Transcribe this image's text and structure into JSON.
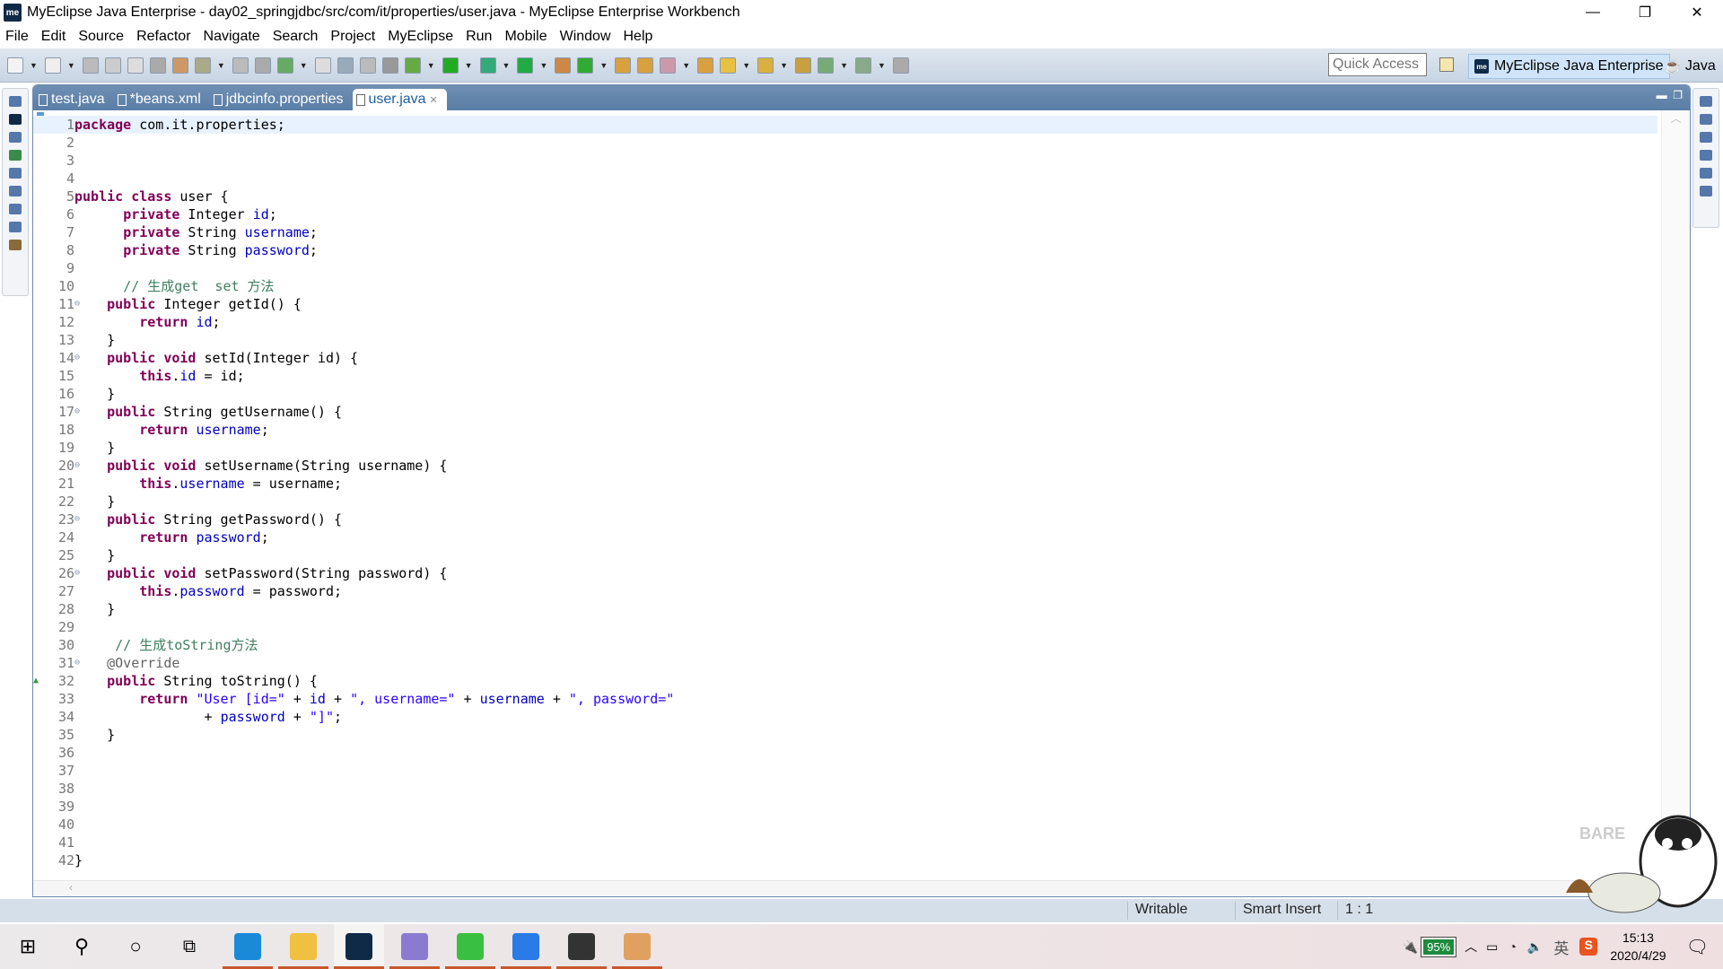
{
  "window": {
    "title": "MyEclipse Java Enterprise - day02_springjdbc/src/com/it/properties/user.java - MyEclipse Enterprise Workbench",
    "logo": "me"
  },
  "menu": [
    "File",
    "Edit",
    "Source",
    "Refactor",
    "Navigate",
    "Search",
    "Project",
    "MyEclipse",
    "Run",
    "Mobile",
    "Window",
    "Help"
  ],
  "toolbar": {
    "quick_access_placeholder": "Quick Access",
    "perspective_active": "MyEclipse Java Enterprise",
    "perspective_other": "Java"
  },
  "tabs": [
    {
      "label": "test.java"
    },
    {
      "label": "*beans.xml"
    },
    {
      "label": "jdbcinfo.properties"
    },
    {
      "label": "user.java",
      "active": true
    }
  ],
  "code": [
    [
      [
        "kw",
        "package"
      ],
      [
        "p",
        " com.it.properties;"
      ]
    ],
    [],
    [],
    [],
    [
      [
        "kw",
        "public"
      ],
      [
        "p",
        " "
      ],
      [
        "kw",
        "class"
      ],
      [
        "p",
        " user {"
      ]
    ],
    [
      [
        "p",
        "      "
      ],
      [
        "kw",
        "private"
      ],
      [
        "p",
        " Integer "
      ],
      [
        "fd",
        "id"
      ],
      [
        "p",
        ";"
      ]
    ],
    [
      [
        "p",
        "      "
      ],
      [
        "kw",
        "private"
      ],
      [
        "p",
        " String "
      ],
      [
        "fd",
        "username"
      ],
      [
        "p",
        ";"
      ]
    ],
    [
      [
        "p",
        "      "
      ],
      [
        "kw",
        "private"
      ],
      [
        "p",
        " String "
      ],
      [
        "fd",
        "password"
      ],
      [
        "p",
        ";"
      ]
    ],
    [],
    [
      [
        "p",
        "      "
      ],
      [
        "cm",
        "// 生成get  set 方法"
      ]
    ],
    [
      [
        "p",
        "    "
      ],
      [
        "kw",
        "public"
      ],
      [
        "p",
        " Integer getId() {"
      ]
    ],
    [
      [
        "p",
        "        "
      ],
      [
        "kw",
        "return"
      ],
      [
        "p",
        " "
      ],
      [
        "fd",
        "id"
      ],
      [
        "p",
        ";"
      ]
    ],
    [
      [
        "p",
        "    }"
      ]
    ],
    [
      [
        "p",
        "    "
      ],
      [
        "kw",
        "public"
      ],
      [
        "p",
        " "
      ],
      [
        "kw",
        "void"
      ],
      [
        "p",
        " setId(Integer id) {"
      ]
    ],
    [
      [
        "p",
        "        "
      ],
      [
        "kw",
        "this"
      ],
      [
        "p",
        "."
      ],
      [
        "fd",
        "id"
      ],
      [
        "p",
        " = id;"
      ]
    ],
    [
      [
        "p",
        "    }"
      ]
    ],
    [
      [
        "p",
        "    "
      ],
      [
        "kw",
        "public"
      ],
      [
        "p",
        " String getUsername() {"
      ]
    ],
    [
      [
        "p",
        "        "
      ],
      [
        "kw",
        "return"
      ],
      [
        "p",
        " "
      ],
      [
        "fd",
        "username"
      ],
      [
        "p",
        ";"
      ]
    ],
    [
      [
        "p",
        "    }"
      ]
    ],
    [
      [
        "p",
        "    "
      ],
      [
        "kw",
        "public"
      ],
      [
        "p",
        " "
      ],
      [
        "kw",
        "void"
      ],
      [
        "p",
        " setUsername(String username) {"
      ]
    ],
    [
      [
        "p",
        "        "
      ],
      [
        "kw",
        "this"
      ],
      [
        "p",
        "."
      ],
      [
        "fd",
        "username"
      ],
      [
        "p",
        " = username;"
      ]
    ],
    [
      [
        "p",
        "    }"
      ]
    ],
    [
      [
        "p",
        "    "
      ],
      [
        "kw",
        "public"
      ],
      [
        "p",
        " String getPassword() {"
      ]
    ],
    [
      [
        "p",
        "        "
      ],
      [
        "kw",
        "return"
      ],
      [
        "p",
        " "
      ],
      [
        "fd",
        "password"
      ],
      [
        "p",
        ";"
      ]
    ],
    [
      [
        "p",
        "    }"
      ]
    ],
    [
      [
        "p",
        "    "
      ],
      [
        "kw",
        "public"
      ],
      [
        "p",
        " "
      ],
      [
        "kw",
        "void"
      ],
      [
        "p",
        " setPassword(String password) {"
      ]
    ],
    [
      [
        "p",
        "        "
      ],
      [
        "kw",
        "this"
      ],
      [
        "p",
        "."
      ],
      [
        "fd",
        "password"
      ],
      [
        "p",
        " = password;"
      ]
    ],
    [
      [
        "p",
        "    }"
      ]
    ],
    [],
    [
      [
        "p",
        "     "
      ],
      [
        "cm",
        "// 生成toString方法"
      ]
    ],
    [
      [
        "p",
        "    "
      ],
      [
        "an",
        "@Override"
      ]
    ],
    [
      [
        "p",
        "    "
      ],
      [
        "kw",
        "public"
      ],
      [
        "p",
        " String toString() {"
      ]
    ],
    [
      [
        "p",
        "        "
      ],
      [
        "kw",
        "return"
      ],
      [
        "p",
        " "
      ],
      [
        "st",
        "\"User [id=\""
      ],
      [
        "p",
        " + "
      ],
      [
        "fd",
        "id"
      ],
      [
        "p",
        " + "
      ],
      [
        "st",
        "\", username=\""
      ],
      [
        "p",
        " + "
      ],
      [
        "fd",
        "username"
      ],
      [
        "p",
        " + "
      ],
      [
        "st",
        "\", password=\""
      ]
    ],
    [
      [
        "p",
        "                + "
      ],
      [
        "fd",
        "password"
      ],
      [
        "p",
        " + "
      ],
      [
        "st",
        "\"]\""
      ],
      [
        "p",
        ";"
      ]
    ],
    [
      [
        "p",
        "    }"
      ]
    ],
    [],
    [],
    [],
    [],
    [],
    [],
    [
      [
        "p",
        "}"
      ]
    ]
  ],
  "folds": [
    11,
    14,
    17,
    20,
    23,
    26,
    31
  ],
  "override_marker_line": 32,
  "status": {
    "writable": "Writable",
    "insert_mode": "Smart Insert",
    "position": "1 : 1"
  },
  "taskbar": {
    "apps": [
      "Microsoft Edge",
      "File Explorer",
      "MyEclipse",
      "MySQL tool",
      "WeChat",
      "WPS Office",
      "Video player",
      "Paint"
    ],
    "battery": "95%",
    "ime": "英",
    "time": "15:13",
    "date": "2020/4/29"
  },
  "colors": {
    "keyword": "#7f0055",
    "field": "#0000c0",
    "string": "#2a00ff",
    "comment": "#3f7f5f",
    "annotation": "#646464",
    "tab_bar": "#5a7ea6",
    "taskbar_underline": "#c8572c"
  }
}
